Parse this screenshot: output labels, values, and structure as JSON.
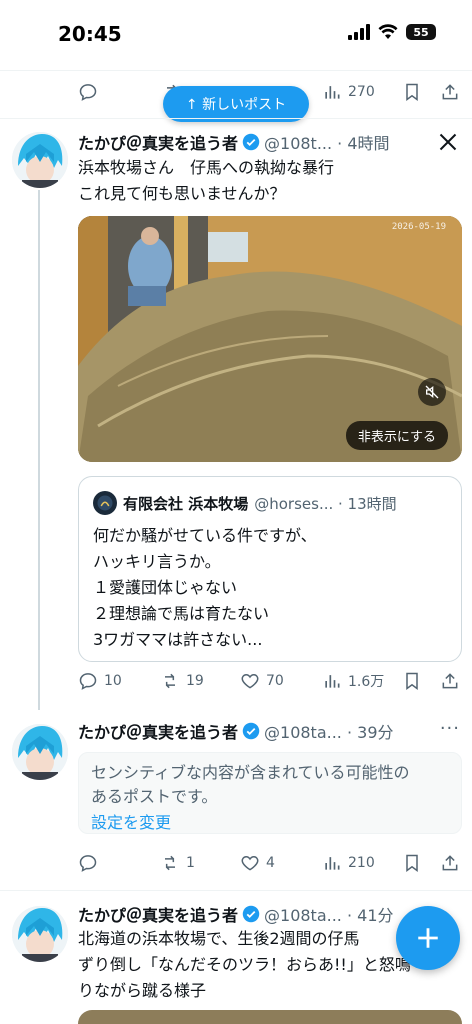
{
  "status_bar": {
    "time": "20:45",
    "battery": "55"
  },
  "top_actions": {
    "views": "270"
  },
  "new_post_pill": {
    "label": "↑ 新しいポスト"
  },
  "tweet1": {
    "name": "たかぴ＠真実を追う者",
    "meta": "@108t... · 4時間",
    "text": "浜本牧場さん　仔馬への執拗な暴行\nこれ見て何も思いませんか？",
    "media_stamp": "2026-05-19",
    "media_hide_label": "非表示にする",
    "quote": {
      "name": "有限会社 浜本牧場",
      "meta": "@horses... · 13時間",
      "text": "何だか騒がせている件ですが、\nハッキリ言うか。\n１愛護団体じゃない\n２理想論で馬は育たない\n3ワガママは許さない..."
    },
    "actions": {
      "replies": "10",
      "reposts": "19",
      "likes": "70",
      "views": "1.6万"
    }
  },
  "tweet2": {
    "name": "たかぴ＠真実を追う者",
    "meta": "@108ta... · 39分",
    "sensitive_text": "センシティブな内容が含まれている可能性の\nあるポストです。",
    "sensitive_link": "設定を変更",
    "actions": {
      "replies": "",
      "reposts": "1",
      "likes": "4",
      "views": "210"
    }
  },
  "tweet3": {
    "name": "たかぴ＠真実を追う者",
    "meta": "@108ta... · 41分",
    "text": "北海道の浜本牧場で、生後2週間の仔馬\nずり倒し「なんだそのツラ！おらあ!!」と怒鳴\nりながら蹴る様子"
  },
  "colors": {
    "accent": "#1d9bf0",
    "text": "#0f1419",
    "muted": "#536471",
    "verified": "#1d9bf0"
  },
  "icons": [
    "reply-icon",
    "repost-icon",
    "like-icon",
    "views-icon",
    "bookmark-icon",
    "share-icon",
    "grok-x-icon",
    "verified-badge-icon",
    "compose-plus-icon"
  ]
}
